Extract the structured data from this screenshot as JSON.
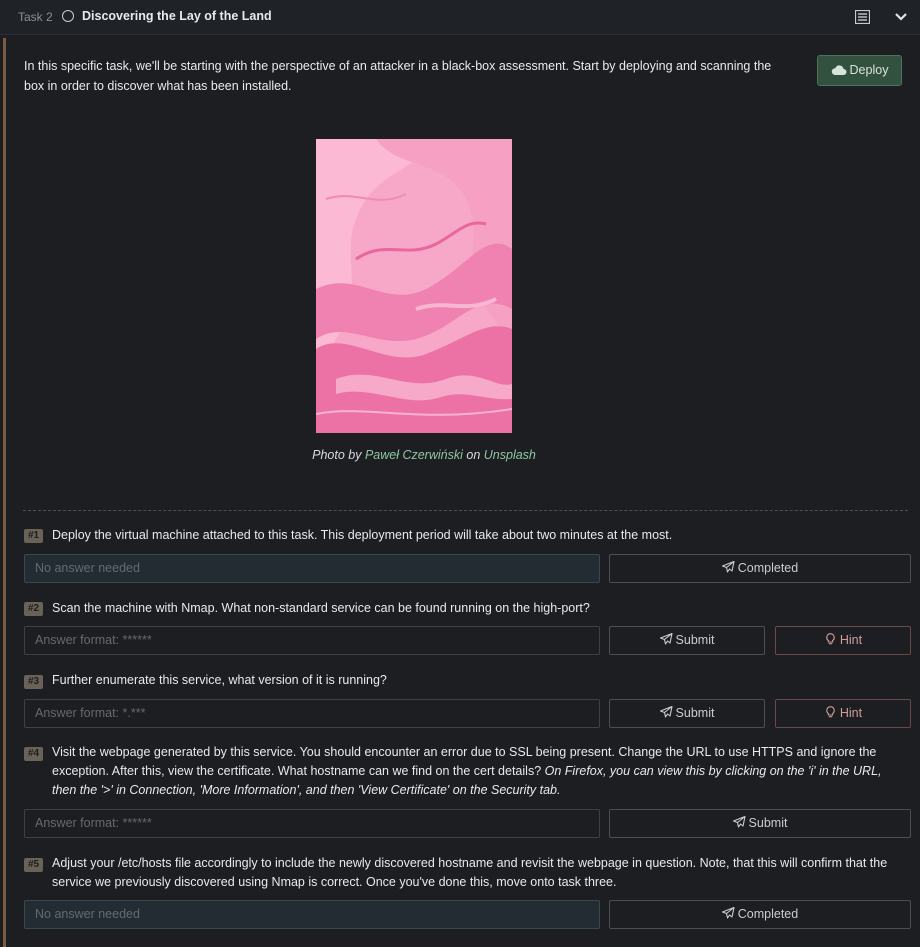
{
  "header": {
    "task_label": "Task 2",
    "task_title": "Discovering the Lay of the Land"
  },
  "intro": {
    "text": "In this specific task, we'll be starting with the perspective of an attacker in a black-box assessment. Start by deploying and scanning the box in order to discover what has been installed.",
    "deploy_label": "Deploy"
  },
  "caption": {
    "prefix": "Photo by",
    "author": "Paweł Czerwiński",
    "middle": "on",
    "site": "Unsplash"
  },
  "questions": [
    {
      "number": "#1",
      "text": "Deploy the virtual machine attached to this task. This deployment period will take about two minutes at the most.",
      "answer": "No answer needed",
      "button": "Completed"
    },
    {
      "number": "#2",
      "text": "Scan the machine with Nmap. What non-standard service can be found running on the high-port?",
      "placeholder": "Answer format: ******",
      "button": "Submit",
      "hint": "Hint"
    },
    {
      "number": "#3",
      "text": "Further enumerate this service, what version of it is running?",
      "placeholder": "Answer format: *.***",
      "button": "Submit",
      "hint": "Hint"
    },
    {
      "number": "#4",
      "text": "Visit the webpage generated by this service. You should encounter an error due to SSL being present. Change the URL to use HTTPS and ignore the exception. After this, view the certificate. What hostname can we find on the cert details?",
      "text_italic": "On Firefox, you can view this by clicking on the 'i' in the URL, then the '>' in Connection, 'More Information', and then 'View Certificate' on the Security tab.",
      "placeholder": "Answer format: ******",
      "button": "Submit"
    },
    {
      "number": "#5",
      "text": "Adjust your /etc/hosts file accordingly to include the newly discovered hostname and revisit the webpage in question. Note, that this will confirm that the service we previously discovered using Nmap is correct. Once you've done this, move onto task three.",
      "answer": "No answer needed",
      "button": "Completed"
    }
  ],
  "colors": {
    "accent_green": "#33513f",
    "link_green": "#8fc7a4",
    "hint_red": "#d39b9b",
    "panel_border": "#7a5c44",
    "photo_pink": "#f49ac0"
  },
  "icons": {
    "status": "circle-icon",
    "list": "list-icon",
    "toggle": "chevron-down-icon",
    "deploy": "cloud-icon",
    "submit": "paper-plane-icon",
    "hint": "lightbulb-icon"
  }
}
